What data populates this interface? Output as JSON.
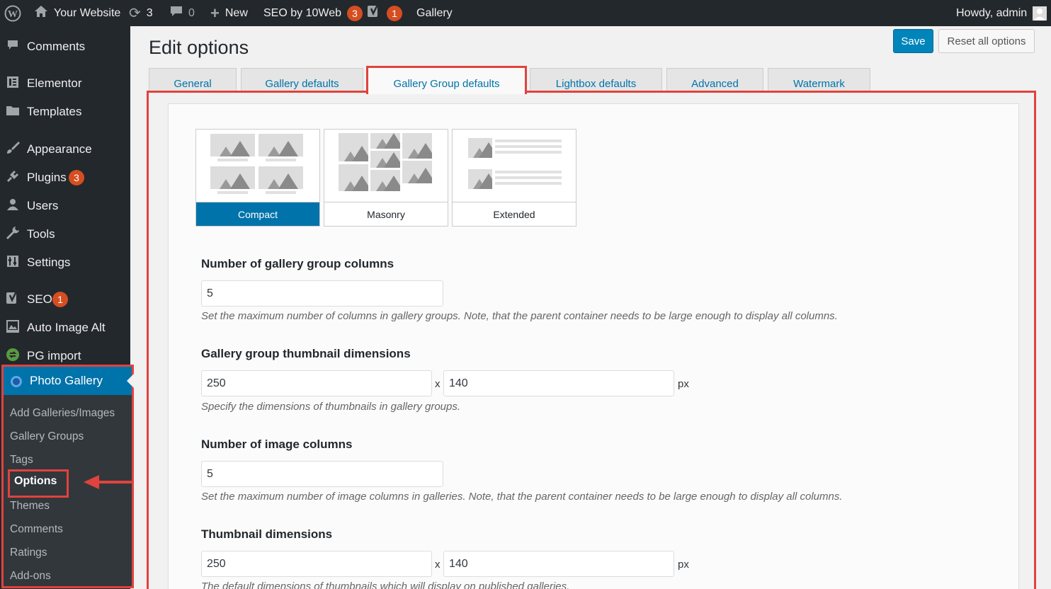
{
  "adminbar": {
    "wp_logo": "wordpress-icon",
    "site_name": "Your Website",
    "updates_count": "3",
    "comments_count": "0",
    "new_label": "New",
    "seo_label": "SEO by 10Web",
    "seo_badge": "3",
    "yoast_badge": "1",
    "gallery_label": "Gallery",
    "howdy": "Howdy, admin"
  },
  "sidebar": {
    "items": [
      {
        "label": "Comments",
        "icon": "comment-icon"
      },
      {
        "label": "Elementor",
        "icon": "elementor-icon"
      },
      {
        "label": "Templates",
        "icon": "folder-icon"
      },
      {
        "label": "Appearance",
        "icon": "brush-icon"
      },
      {
        "label": "Plugins",
        "icon": "plugin-icon",
        "badge": "3"
      },
      {
        "label": "Users",
        "icon": "user-icon"
      },
      {
        "label": "Tools",
        "icon": "wrench-icon"
      },
      {
        "label": "Settings",
        "icon": "settings-icon"
      },
      {
        "label": "SEO",
        "icon": "yoast-icon",
        "badge": "1"
      },
      {
        "label": "Auto Image Alt",
        "icon": "image-icon"
      },
      {
        "label": "PG import",
        "icon": "import-icon"
      }
    ],
    "photo_gallery": {
      "label": "Photo Gallery",
      "submenu": [
        "Add Galleries/Images",
        "Gallery Groups",
        "Tags",
        "Options",
        "Themes",
        "Comments",
        "Ratings",
        "Add-ons"
      ]
    }
  },
  "header": {
    "title": "Edit options",
    "save": "Save",
    "reset": "Reset all options"
  },
  "tabs": [
    "General",
    "Gallery defaults",
    "Gallery Group defaults",
    "Lightbox defaults",
    "Advanced",
    "Watermark"
  ],
  "views": [
    "Compact",
    "Masonry",
    "Extended"
  ],
  "fields": {
    "group_columns": {
      "label": "Number of gallery group columns",
      "value": "5",
      "desc": "Set the maximum number of columns in gallery groups. Note, that the parent container needs to be large enough to display all columns."
    },
    "group_thumb": {
      "label": "Gallery group thumbnail dimensions",
      "width": "250",
      "height": "140",
      "x": "x",
      "unit": "px",
      "desc": "Specify the dimensions of thumbnails in gallery groups."
    },
    "image_columns": {
      "label": "Number of image columns",
      "value": "5",
      "desc": "Set the maximum number of image columns in galleries. Note, that the parent container needs to be large enough to display all columns."
    },
    "thumb": {
      "label": "Thumbnail dimensions",
      "width": "250",
      "height": "140",
      "x": "x",
      "unit": "px",
      "desc": "The default dimensions of thumbnails which will display on published galleries."
    }
  }
}
